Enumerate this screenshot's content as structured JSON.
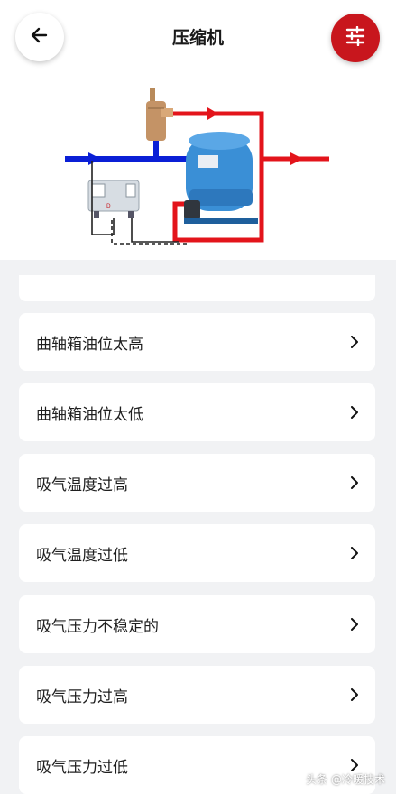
{
  "header": {
    "title": "压缩机",
    "back_icon": "arrow-left-icon",
    "filter_icon": "sliders-icon"
  },
  "colors": {
    "accent": "#c8161d",
    "suction_line": "#0a1fd6",
    "discharge_line": "#e3141b",
    "compressor_body": "#3a8fd6"
  },
  "items": [
    {
      "label": "曲轴箱油位太高"
    },
    {
      "label": "曲轴箱油位太低"
    },
    {
      "label": "吸气温度过高"
    },
    {
      "label": "吸气温度过低"
    },
    {
      "label": "吸气压力不稳定的"
    },
    {
      "label": "吸气压力过高"
    },
    {
      "label": "吸气压力过低"
    }
  ],
  "watermark": "头条 @冷暖技术"
}
